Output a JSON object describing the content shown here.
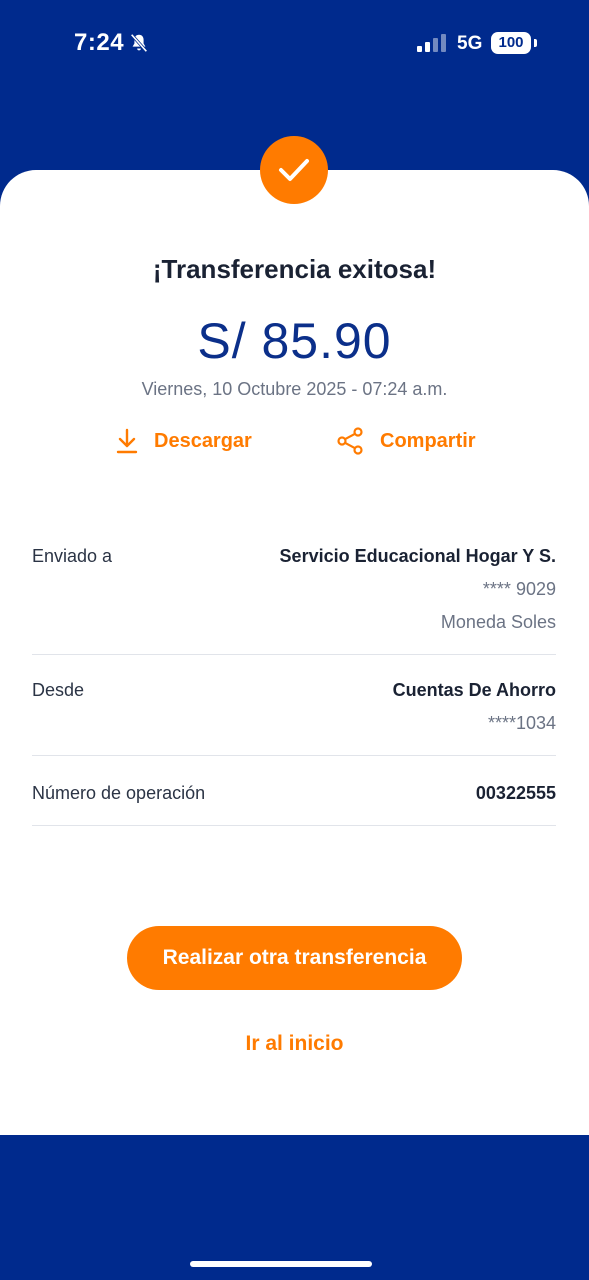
{
  "status_bar": {
    "time": "7:24",
    "network": "5G",
    "battery": "100"
  },
  "receipt": {
    "title": "¡Transferencia exitosa!",
    "amount": "S/ 85.90",
    "datetime": "Viernes, 10 Octubre 2025 - 07:24 a.m."
  },
  "actions": {
    "download_label": "Descargar",
    "share_label": "Compartir"
  },
  "details": {
    "recipient": {
      "label": "Enviado a",
      "name": "Servicio Educacional Hogar Y S.",
      "account": "**** 9029",
      "currency": "Moneda Soles"
    },
    "source": {
      "label": "Desde",
      "account_type": "Cuentas De Ahorro",
      "account": "****1034"
    },
    "operation": {
      "label": "Número de operación",
      "number": "00322555"
    }
  },
  "buttons": {
    "new_transfer_label": "Realizar otra transferencia",
    "home_label": "Ir al inicio"
  },
  "colors": {
    "brand_blue": "#002a8d",
    "accent_orange": "#ff7b00"
  },
  "icons": {
    "success": "check-icon",
    "download": "download-icon",
    "share": "share-icon",
    "silent": "bell-slash-icon"
  }
}
